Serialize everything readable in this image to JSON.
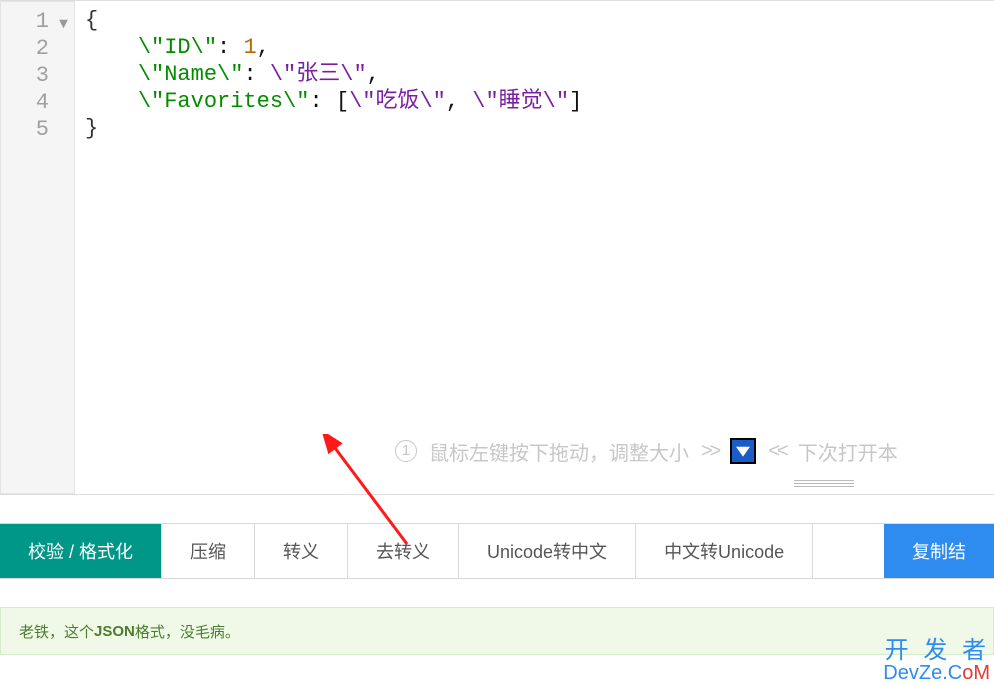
{
  "editor": {
    "lines": [
      "1",
      "2",
      "3",
      "4",
      "5"
    ],
    "code": {
      "l1": "{",
      "l2_key": "\\\"ID\\\"",
      "l2_sep": ": ",
      "l2_val": "1",
      "l2_end": ",",
      "l3_key": "\\\"Name\\\"",
      "l3_sep": ": ",
      "l3_val": "\\\"张三\\\"",
      "l3_end": ",",
      "l4_key": "\\\"Favorites\\\"",
      "l4_sep": ": ",
      "l4_b1": "[",
      "l4_v1": "\\\"吃饭\\\"",
      "l4_c": ", ",
      "l4_v2": "\\\"睡觉\\\"",
      "l4_b2": "]",
      "l5": "}"
    },
    "hint": {
      "num": "1",
      "text": "鼠标左键按下拖动，调整大小",
      "arr_right": ">>",
      "arr_left": "<<",
      "tail": "下次打开本"
    }
  },
  "toolbar": {
    "validate": "校验 / 格式化",
    "minify": "压缩",
    "escape": "转义",
    "unescape": "去转义",
    "u2c": "Unicode转中文",
    "c2u": "中文转Unicode",
    "copy": "复制结"
  },
  "status": {
    "pre": "老铁，这个",
    "bold": "JSON",
    "post": "格式，没毛病。"
  },
  "watermark": {
    "zh": "开 发 者",
    "en_pre": "DevZe.C",
    "en_o": "o",
    "en_m": "M"
  }
}
